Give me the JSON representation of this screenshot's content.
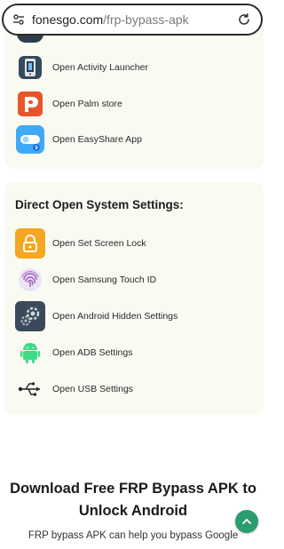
{
  "address_bar": {
    "domain": "fonesgo.com",
    "path": "/frp-bypass-apk"
  },
  "card1": {
    "items": [
      {
        "label": "Open Activity Launcher",
        "icon": "activity-launcher-icon"
      },
      {
        "label": "Open Palm store",
        "icon": "palm-store-icon"
      },
      {
        "label": "Open EasyShare App",
        "icon": "easyshare-icon"
      }
    ]
  },
  "card2": {
    "title": "Direct Open System Settings:",
    "items": [
      {
        "label": "Open Set Screen Lock",
        "icon": "lock-icon"
      },
      {
        "label": "Open Samsung Touch ID",
        "icon": "fingerprint-icon"
      },
      {
        "label": "Open Android Hidden Settings",
        "icon": "gears-icon"
      },
      {
        "label": "Open ADB Settings",
        "icon": "android-icon"
      },
      {
        "label": "Open USB Settings",
        "icon": "usb-icon"
      }
    ]
  },
  "article": {
    "heading_line1": "Download Free FRP Bypass APK to",
    "heading_line2": "Unlock Android",
    "paragraph": "FRP bypass APK can help you bypass Google"
  },
  "colors": {
    "card_bg": "#f9fbf2",
    "fab": "#2a9d6f",
    "palm_orange": "#e8552b",
    "lock_amber": "#f5a623",
    "android_green": "#3ddc84",
    "easyshare_blue": "#3fa9f5"
  }
}
